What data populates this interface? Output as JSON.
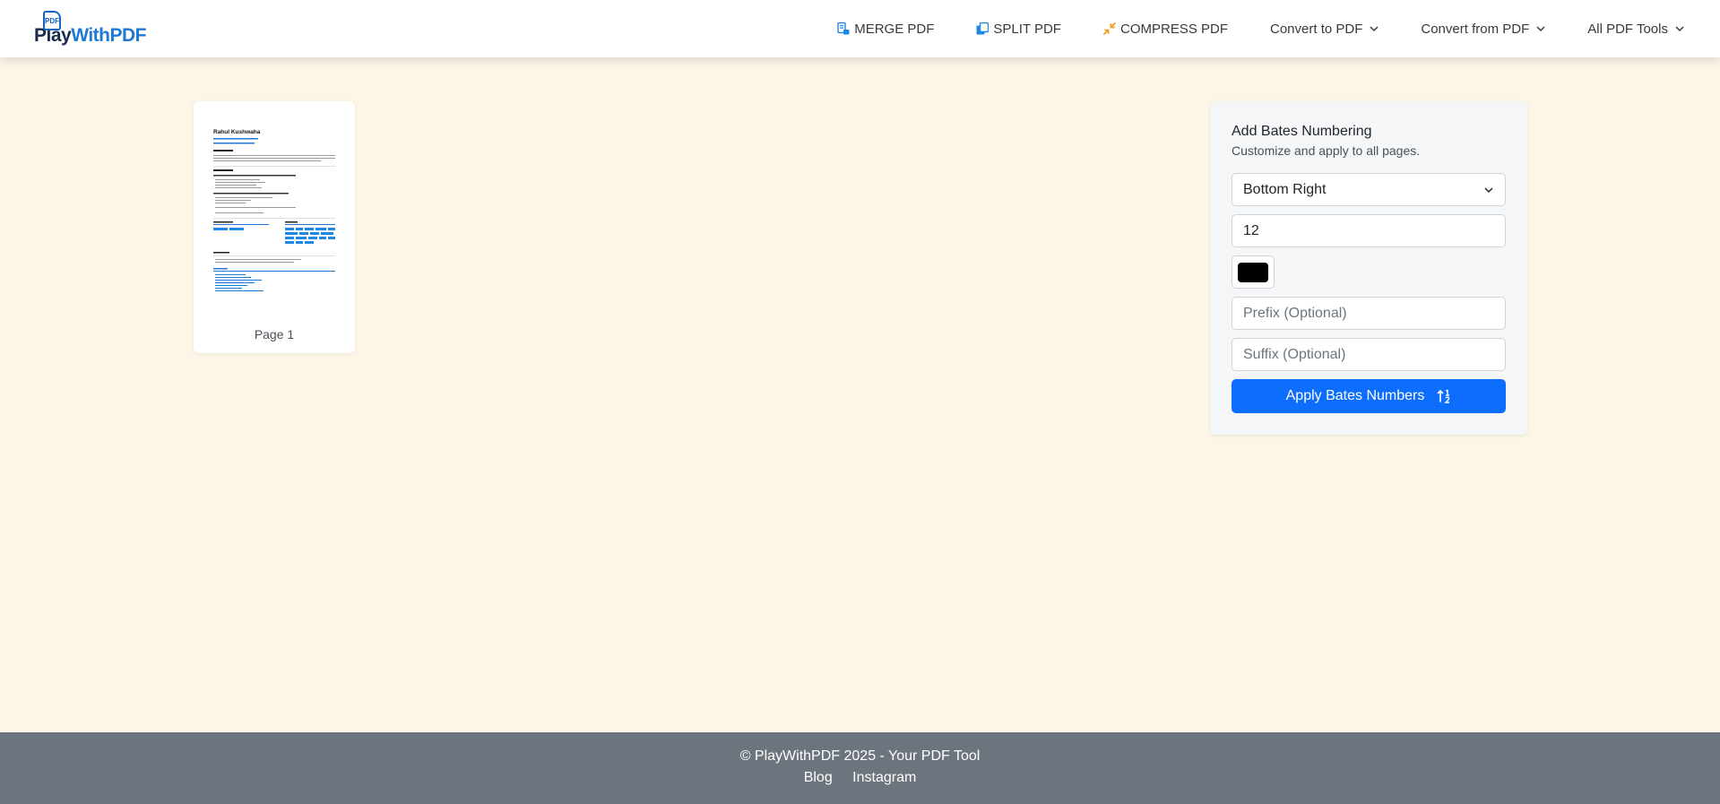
{
  "brand": {
    "badge": "PDF",
    "name_part1": "Play",
    "name_part2": "WithPDF"
  },
  "nav": {
    "items": [
      {
        "label": "MERGE PDF",
        "icon": "merge-icon",
        "color": "#1e88e5"
      },
      {
        "label": "SPLIT PDF",
        "icon": "split-icon",
        "color": "#1e88e5"
      },
      {
        "label": "COMPRESS PDF",
        "icon": "compress-icon",
        "color": "#f29d1b"
      },
      {
        "label": "Convert to PDF",
        "icon": "chevron-down-icon"
      },
      {
        "label": "Convert from PDF",
        "icon": "chevron-down-icon"
      },
      {
        "label": "All PDF Tools",
        "icon": "chevron-down-icon"
      }
    ]
  },
  "preview": {
    "page_label": "Page 1",
    "doc_name": "Rahul Kushwaha"
  },
  "panel": {
    "title": "Add Bates Numbering",
    "subtitle": "Customize and apply to all pages.",
    "position_value": "Bottom Right",
    "font_size_value": "12",
    "color_value": "#000000",
    "prefix_placeholder": "Prefix (Optional)",
    "suffix_placeholder": "Suffix (Optional)",
    "apply_label": "Apply Bates Numbers"
  },
  "footer": {
    "copyright": "© PlayWithPDF 2025 - Your PDF Tool",
    "links": [
      "Blog",
      "Instagram"
    ]
  },
  "colors": {
    "accent": "#0d6efd",
    "background": "#fdf6e7",
    "footer": "#6c757d"
  }
}
